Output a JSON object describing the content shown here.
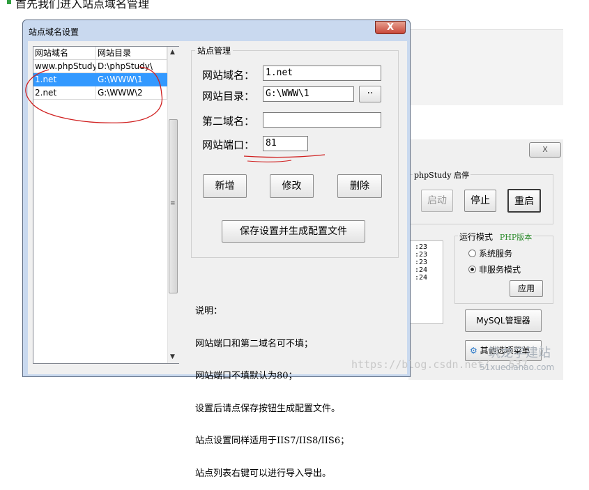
{
  "page": {
    "heading_fragment": "首先我们进入站点域名管理",
    "accent_color": "#2f9e3f"
  },
  "dialog": {
    "title": "站点域名设置",
    "close_glyph": "X",
    "list": {
      "columns": [
        "网站域名",
        "网站目录"
      ],
      "rows": [
        {
          "domain": "www.phpStudy",
          "dir": "D:\\phpStudy\\",
          "selected": false
        },
        {
          "domain": "1.net",
          "dir": "G:\\WWW\\1",
          "selected": true
        },
        {
          "domain": "2.net",
          "dir": "G:\\WWW\\2",
          "selected": false
        }
      ],
      "scroll_up": "▲",
      "scroll_down": "▼",
      "scroll_grip": "≡"
    },
    "group_title": "站点管理",
    "fields": {
      "domain": {
        "label": "网站域名：",
        "value": "1.net"
      },
      "dir": {
        "label": "网站目录：",
        "value": "G:\\WWW\\1",
        "browse": "··"
      },
      "second": {
        "label": "第二域名：",
        "value": ""
      },
      "port": {
        "label": "网站端口：",
        "value": "81"
      }
    },
    "buttons": {
      "add": "新增",
      "modify": "修改",
      "delete": "删除",
      "save": "保存设置并生成配置文件"
    },
    "notes": [
      "说明：",
      "网站端口和第二域名可不填；",
      "网站端口不填默认为80；",
      "设置后请点保存按钮生成配置文件。",
      "站点设置同样适用于IIS7/IIS8/IIS6；",
      "站点列表右键可以进行导入导出。"
    ],
    "selected_color": "#3399ff"
  },
  "background_window": {
    "close_glyph": "X",
    "status_label": "phpStudy 启停",
    "buttons": {
      "start": "启动",
      "stop": "停止",
      "restart": "重启",
      "apply": "应用",
      "mysql": "MySQL管理器",
      "other": "其他选项菜单"
    },
    "log_times": [
      ":23",
      ":23",
      ":23",
      ":24",
      ":24"
    ],
    "mode_group": "运行模式",
    "php_version": "PHP版本",
    "radio_system": "系统服务",
    "radio_nonservice": "非服务模式",
    "radio_selected": "nonservice",
    "php_color": "#2a8a2a"
  },
  "watermarks": {
    "url": "https://blog.csdn.net/...537",
    "brand": "筑龙学建站",
    "brand_sub": "51xuedianao.com"
  },
  "annotation_color": "#d02020"
}
